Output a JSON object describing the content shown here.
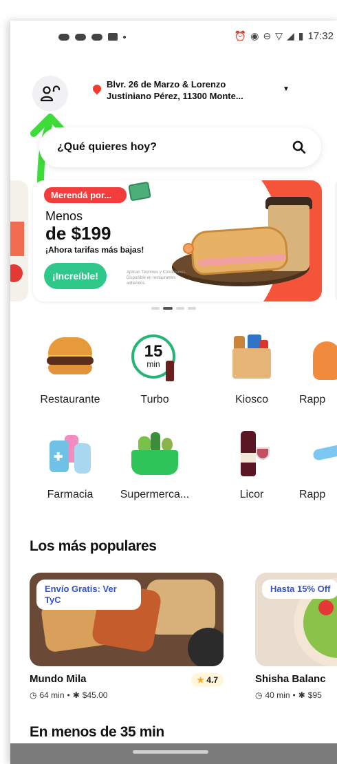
{
  "status_bar": {
    "time": "17:32",
    "icons": [
      "notification-icon",
      "notification-icon",
      "notification-icon",
      "youtube-icon",
      "alarm-icon",
      "vibrate-icon",
      "dnd-icon",
      "wifi-icon",
      "signal-icon",
      "battery-icon"
    ]
  },
  "header": {
    "address_line1": "Blvr. 26 de Marzo & Lorenzo",
    "address_line2": "Justiniano Pérez, 11300 Monte..."
  },
  "search": {
    "placeholder": "¿Qué quieres hoy?"
  },
  "banner": {
    "tag": "Merendá por...",
    "line1": "Menos",
    "line2": "de $199",
    "line3": "¡Ahora tarifas más bajas!",
    "button": "¡Increíble!",
    "fine_print": "Aplican Términos y Condiciones. Disponible en restaurantes adheridos.",
    "pager_count": 4,
    "pager_active": 1
  },
  "categories": [
    {
      "label": "Restaurante",
      "icon": "burger-icon"
    },
    {
      "label": "Turbo",
      "icon": "turbo-15-min-icon",
      "badge_num": "15",
      "badge_unit": "min"
    },
    {
      "label": "Kiosco",
      "icon": "kiosco-bag-icon"
    },
    {
      "label": "Rapp",
      "icon": "rappi-courier-icon"
    },
    {
      "label": "Farmacia",
      "icon": "pharmacy-icon"
    },
    {
      "label": "Supermerca...",
      "icon": "supermarket-basket-icon"
    },
    {
      "label": "Licor",
      "icon": "liquor-icon"
    },
    {
      "label": "Rapp",
      "icon": "rappi-travel-icon"
    }
  ],
  "sections": {
    "popular_title": "Los más populares",
    "fast_title": "En menos de 35 min"
  },
  "restaurants": [
    {
      "name": "Mundo Mila",
      "badge": "Envío Gratis: Ver TyC",
      "rating": "4.7",
      "time": "64 min",
      "fee": "$45.00"
    },
    {
      "name": "Shisha Balanc",
      "badge": "Hasta 15% Off",
      "time": "40 min",
      "fee": "$95"
    }
  ],
  "colors": {
    "brand_red": "#f53b2d",
    "accent_green": "#2fc88a",
    "annotation_green": "#3ddc3a",
    "badge_blue": "#3253c9"
  }
}
